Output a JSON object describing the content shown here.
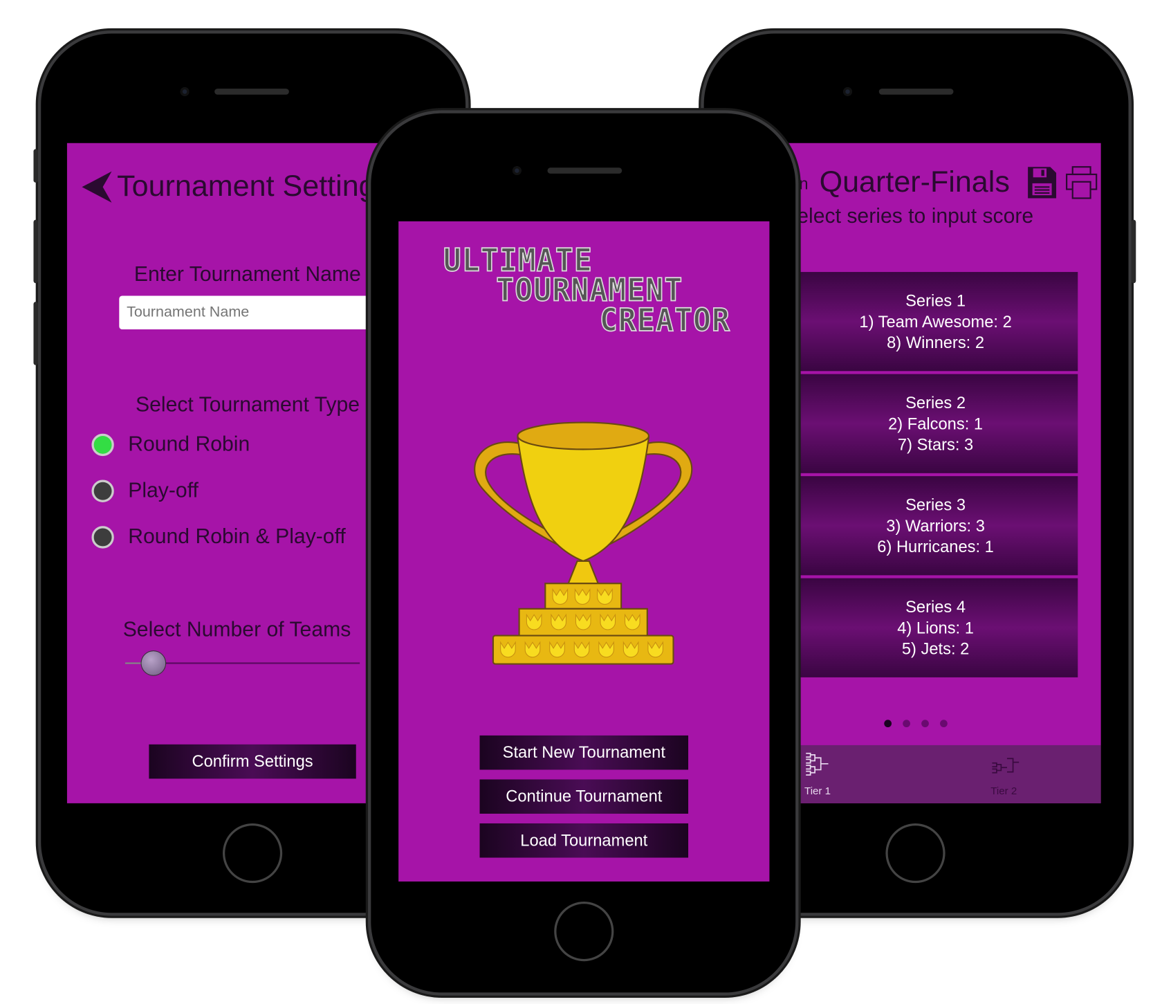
{
  "settings_screen": {
    "title": "Tournament Setting",
    "back_icon": "back-arrow-icon",
    "name_label": "Enter Tournament Name",
    "name_input": {
      "value": "",
      "placeholder": "Tournament Name"
    },
    "type_label": "Select Tournament Type",
    "types": [
      {
        "label": "Round Robin",
        "selected": true
      },
      {
        "label": "Play-off",
        "selected": false
      },
      {
        "label": "Round Robin & Play-off",
        "selected": false
      }
    ],
    "teams_label": "Select Number of Teams",
    "teams_slider_fraction": 0.12,
    "confirm_label": "Confirm Settings"
  },
  "home_screen": {
    "logo_lines": [
      "ULTIMATE",
      "TOURNAMENT",
      "CREATOR"
    ],
    "buttons": [
      "Start New Tournament",
      "Continue Tournament",
      "Load Tournament"
    ]
  },
  "bracket_screen": {
    "title_prefix": "in",
    "title": "Quarter-Finals",
    "subtitle": "elect series to input score",
    "series": [
      {
        "name": "Series 1",
        "team1": "1) Team Awesome: 2",
        "team2": "8) Winners: 2"
      },
      {
        "name": "Series 2",
        "team1": "2) Falcons: 1",
        "team2": "7) Stars: 3"
      },
      {
        "name": "Series 3",
        "team1": "3) Warriors: 3",
        "team2": "6) Hurricanes: 1"
      },
      {
        "name": "Series 4",
        "team1": "4) Lions: 1",
        "team2": "5) Jets: 2"
      }
    ],
    "page_count": 4,
    "current_page": 1,
    "tabs": [
      {
        "label": "Tier 1",
        "active": true
      },
      {
        "label": "Tier 2",
        "active": false
      }
    ]
  },
  "colors": {
    "background": "#a614a8",
    "selected_radio": "#33dd44",
    "tab_bar": "#6a2070"
  }
}
